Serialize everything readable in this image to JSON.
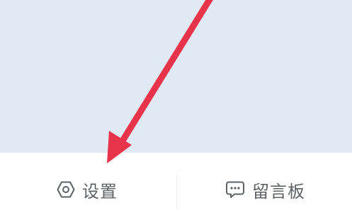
{
  "colors": {
    "content_background": "#e1e9f3",
    "bar_background": "#ffffff",
    "text": "#5e6166",
    "annotation_arrow": "#e8344a"
  },
  "bottom_bar": {
    "items": [
      {
        "label": "设置",
        "icon": "hexagon-settings-icon"
      },
      {
        "label": "留言板",
        "icon": "chat-bubble-icon"
      }
    ]
  },
  "annotation": {
    "type": "arrow",
    "points_to": "设置"
  }
}
